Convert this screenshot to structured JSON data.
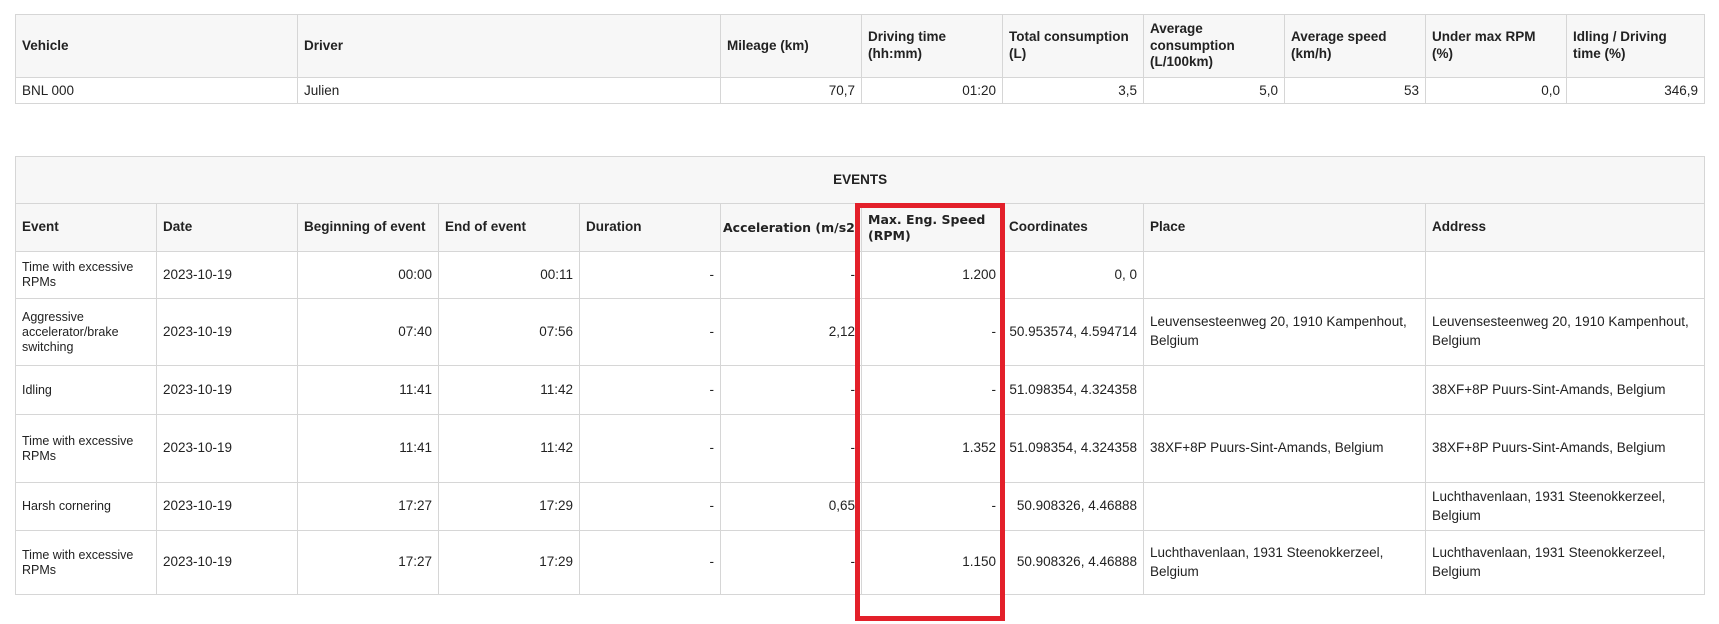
{
  "summary": {
    "headers": [
      "Vehicle",
      "Driver",
      "Mileage (km)",
      "Driving time (hh:mm)",
      "Total consumption (L)",
      "Average consumption (L/100km)",
      "Average speed (km/h)",
      "Under max RPM (%)",
      "Idling / Driving time (%)"
    ],
    "row": [
      "BNL 000",
      "Julien",
      "70,7",
      "01:20",
      "3,5",
      "5,0",
      "53",
      "0,0",
      "346,9"
    ]
  },
  "events": {
    "title": "EVENTS",
    "headers": [
      "Event",
      "Date",
      "Beginning of event",
      "End of event",
      "Duration",
      "Acceleration (m/s2",
      "Max. Eng. Speed (RPM)",
      "Coordinates",
      "Place",
      "Address"
    ],
    "rows": [
      [
        "Time with excessive RPMs",
        "2023-10-19",
        "00:00",
        "00:11",
        "-",
        "-",
        "1.200",
        "0, 0",
        "",
        ""
      ],
      [
        "Aggressive accelerator/brake switching",
        "2023-10-19",
        "07:40",
        "07:56",
        "-",
        "2,12",
        "-",
        "50.953574, 4.594714",
        "Leuvensesteenweg 20, 1910 Kampenhout, Belgium",
        "Leuvensesteenweg 20, 1910 Kampenhout, Belgium"
      ],
      [
        "Idling",
        "2023-10-19",
        "11:41",
        "11:42",
        "-",
        "-",
        "-",
        "51.098354, 4.324358",
        "",
        "38XF+8P Puurs-Sint-Amands, Belgium"
      ],
      [
        "Time with excessive RPMs",
        "2023-10-19",
        "11:41",
        "11:42",
        "-",
        "-",
        "1.352",
        "51.098354, 4.324358",
        "38XF+8P Puurs-Sint-Amands, Belgium",
        "38XF+8P Puurs-Sint-Amands, Belgium"
      ],
      [
        "Harsh cornering",
        "2023-10-19",
        "17:27",
        "17:29",
        "-",
        "0,65",
        "-",
        "50.908326, 4.46888",
        "",
        "Luchthavenlaan, 1931 Steenokkerzeel, Belgium"
      ],
      [
        "Time with excessive RPMs",
        "2023-10-19",
        "17:27",
        "17:29",
        "-",
        "-",
        "1.150",
        "50.908326, 4.46888",
        "Luchthavenlaan, 1931 Steenokkerzeel, Belgium",
        "Luchthavenlaan, 1931 Steenokkerzeel, Belgium"
      ]
    ]
  },
  "highlight_color": "#e3202a"
}
